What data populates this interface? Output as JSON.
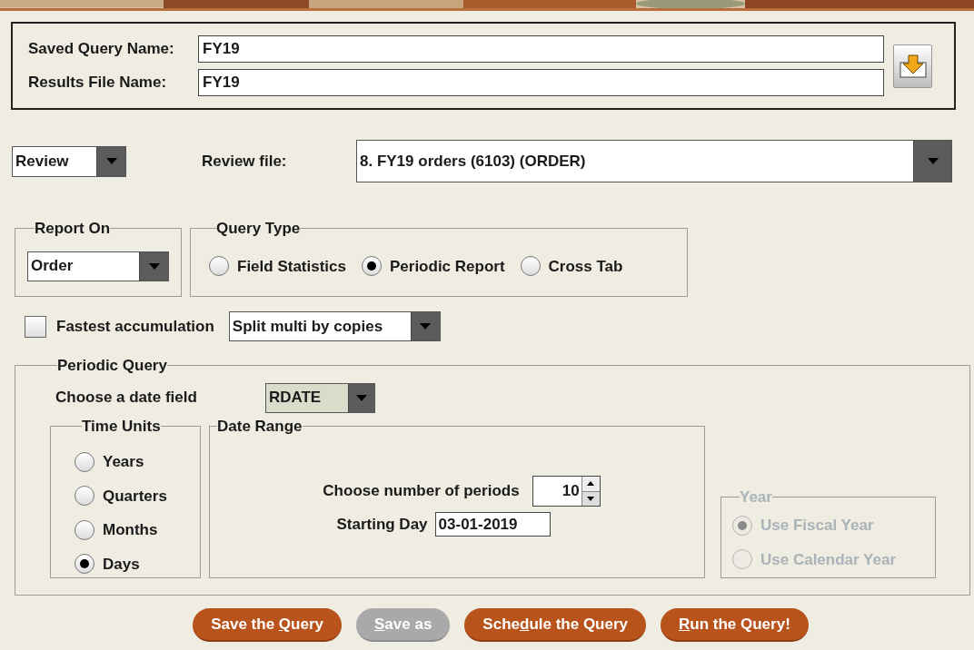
{
  "names": {
    "fields": [
      {
        "label": "Saved Query Name:",
        "value": "FY19"
      },
      {
        "label": "Results File Name:",
        "value": "FY19"
      }
    ]
  },
  "mode_combo": {
    "value": "Review"
  },
  "review_file": {
    "label": "Review file:",
    "value": "8. FY19 orders (6103) (ORDER)"
  },
  "report_on": {
    "title": "Report On",
    "value": "Order"
  },
  "query_type": {
    "title": "Query Type",
    "options": [
      {
        "label": "Field Statistics",
        "selected": false
      },
      {
        "label": "Periodic Report",
        "selected": true
      },
      {
        "label": "Cross Tab",
        "selected": false
      }
    ]
  },
  "fastest": {
    "label": "Fastest accumulation",
    "checked": false
  },
  "split_combo": {
    "value": "Split multi by copies"
  },
  "periodic": {
    "title": "Periodic Query",
    "date_field_label": "Choose a date field",
    "date_field": "RDATE",
    "time_units": {
      "title": "Time Units",
      "options": [
        {
          "label": "Years",
          "selected": false
        },
        {
          "label": "Quarters",
          "selected": false
        },
        {
          "label": "Months",
          "selected": false
        },
        {
          "label": "Days",
          "selected": true
        }
      ]
    },
    "date_range": {
      "title": "Date Range",
      "periods_label": "Choose number of periods",
      "periods": "10",
      "start_label": "Starting Day",
      "start": "03-01-2019"
    },
    "year": {
      "title": "Year",
      "disabled": true,
      "options": [
        {
          "label": "Use Fiscal Year",
          "selected": true
        },
        {
          "label": "Use Calendar Year",
          "selected": false
        }
      ]
    }
  },
  "buttons": [
    {
      "before": "Save the ",
      "mnemonic": "Q",
      "after": "uery",
      "disabled": false
    },
    {
      "mnemonic": "S",
      "after": "ave as",
      "disabled": true
    },
    {
      "before": "Sche",
      "mnemonic": "d",
      "after": "ule the Query",
      "disabled": false
    },
    {
      "mnemonic": "R",
      "after": "un the Query!",
      "disabled": false
    }
  ]
}
